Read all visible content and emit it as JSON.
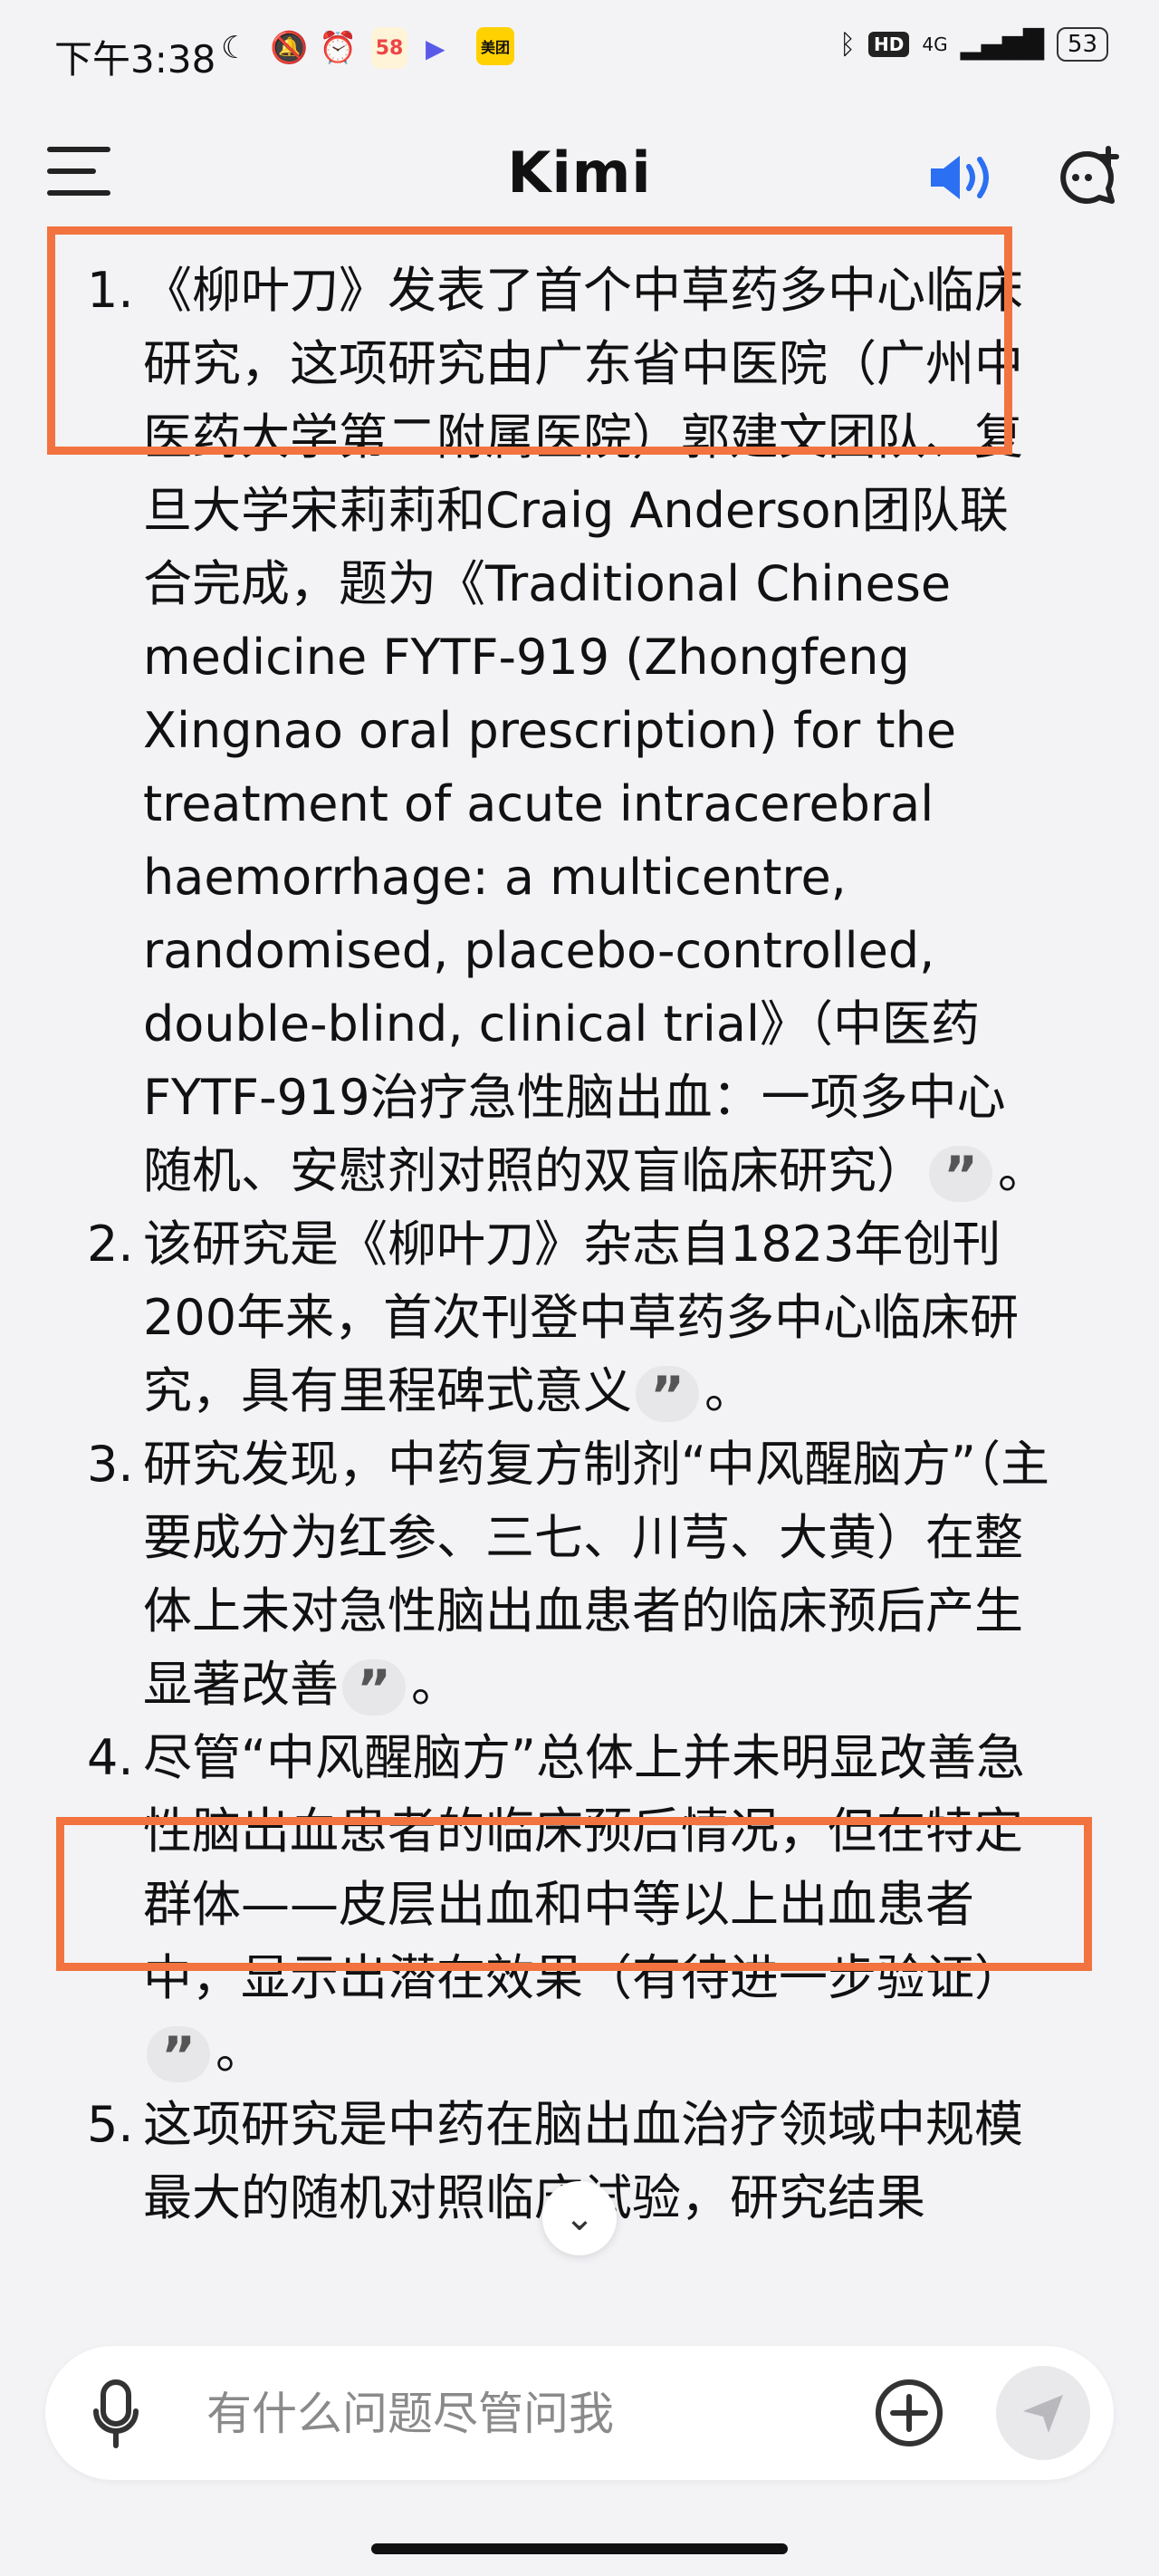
{
  "status_bar": {
    "time": "下午3:38",
    "left_icons": [
      "moon-icon",
      "bell-off-icon",
      "alarm-icon",
      "app58-icon",
      "play-icon",
      "meituan-icon"
    ],
    "app58_label": "58",
    "meituan_label": "美团",
    "network": "4G",
    "hd": "HD",
    "battery": "53"
  },
  "header": {
    "title": "Kimi",
    "accent_color": "#2b6ff2"
  },
  "items": [
    {
      "num": "1.",
      "text": "《柳叶刀》发表了首个中草药多中心临床研究，这项研究由广东省中医院（广州中医药大学第二附属医院）郭建文团队、复旦大学宋莉莉和Craig Anderson团队联合完成，题为《Traditional Chinese medicine FYTF-919 (Zhongfeng Xingnao oral prescription) for the treatment of acute intracerebral haemorrhage: a multicentre, randomised, placebo-controlled, double-blind, clinical trial》（中医药FYTF-919治疗急性脑出血：一项多中心随机、安慰剂对照的双盲临床研究）",
      "tail": "。"
    },
    {
      "num": "2.",
      "text": "该研究是《柳叶刀》杂志自1823年创刊200年来，首次刊登中草药多中心临床研究，具有里程碑式意义",
      "tail": "。"
    },
    {
      "num": "3.",
      "text": "研究发现，中药复方制剂“中风醒脑方”（主要成分为红参、三七、川芎、大黄）在整体上未对急性脑出血患者的临床预后产生显著改善",
      "tail": "。"
    },
    {
      "num": "4.",
      "text": "尽管“中风醒脑方”总体上并未明显改善急性脑出血患者的临床预后情况，但在特定群体——皮层出血和中等以上出血患者中，显示出潜在效果（有待进一步验证）",
      "tail": "。"
    },
    {
      "num": "5.",
      "text": "这项研究是中药在脑出血治疗领域中规模最大的随机对照临床试验，研究结果"
    }
  ],
  "cite_glyph": "”",
  "highlight_color": "#f2733f",
  "input": {
    "placeholder": "有什么问题尽管问我"
  }
}
